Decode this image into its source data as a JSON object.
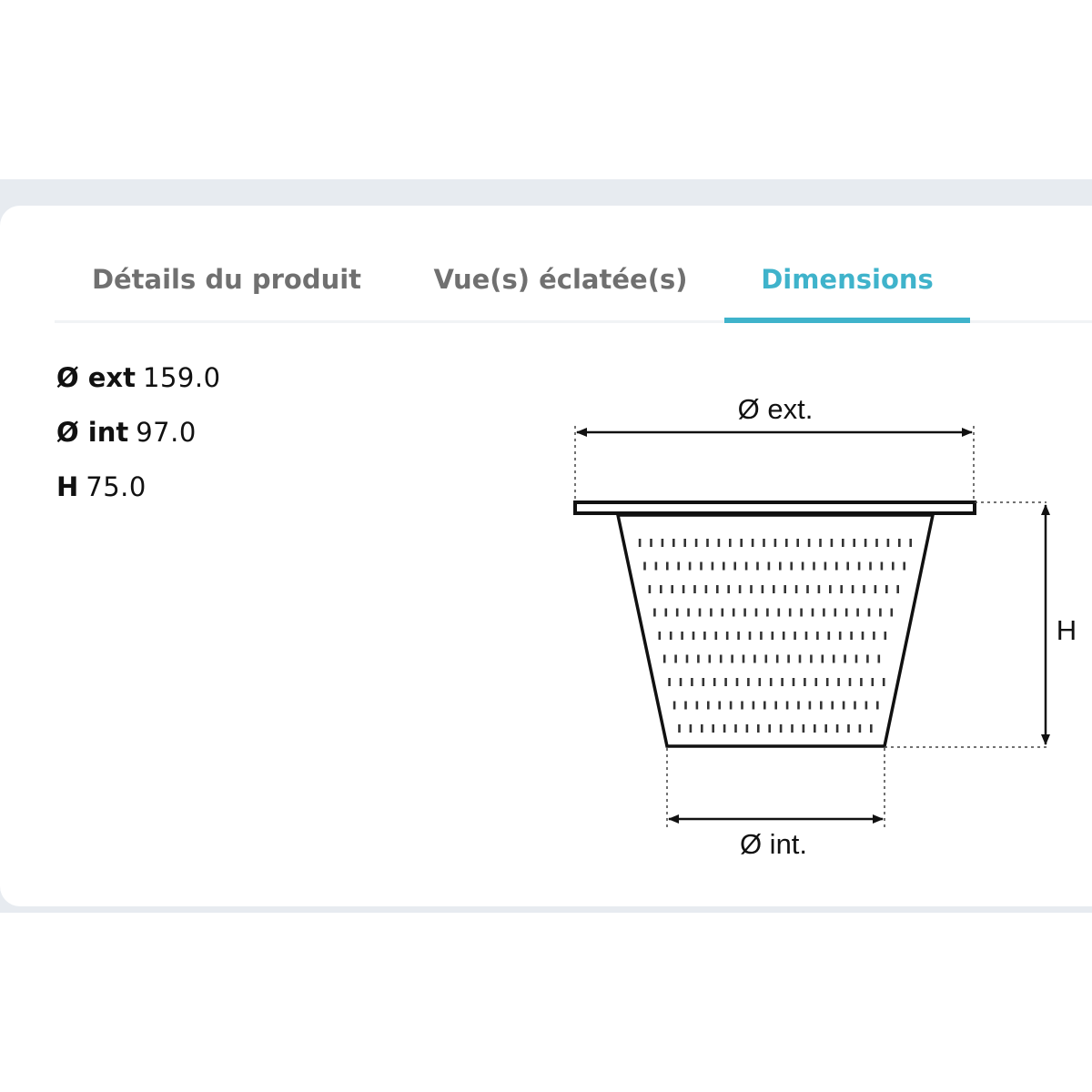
{
  "tabs": [
    {
      "label": "Détails du produit",
      "active": false
    },
    {
      "label": "Vue(s) éclatée(s)",
      "active": false
    },
    {
      "label": "Dimensions",
      "active": true
    }
  ],
  "dimensions": [
    {
      "label": "Ø ext",
      "value": "159.0"
    },
    {
      "label": "Ø int",
      "value": "97.0"
    },
    {
      "label": "H",
      "value": "75.0"
    }
  ],
  "diagram": {
    "ext_label": "Ø ext.",
    "int_label": "Ø int.",
    "h_label": "H"
  },
  "colors": {
    "accent": "#3fb3cb",
    "tab_inactive": "#707070",
    "band": "#e7ebf0"
  }
}
